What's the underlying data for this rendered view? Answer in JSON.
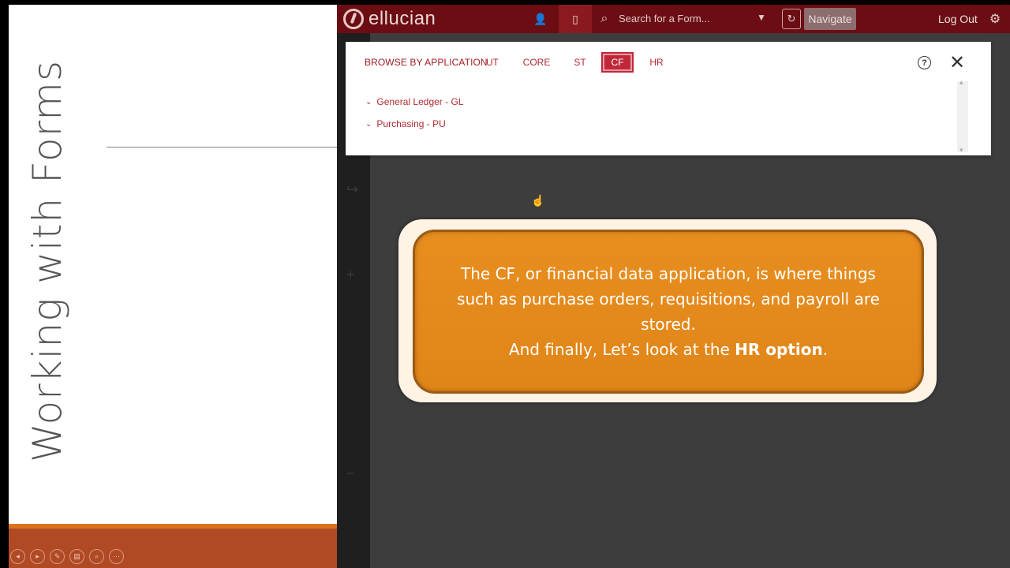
{
  "slide": {
    "title": "Working with Forms",
    "controls": [
      "◂",
      "▸",
      "✎",
      "▤",
      "⌕",
      "⋯"
    ]
  },
  "app": {
    "brand": "ellucian",
    "search_placeholder": "Search for a Form...",
    "navigate_label": "Navigate",
    "logout_label": "Log Out",
    "icons": {
      "user": "👤",
      "doc": "▯",
      "search": "⌕",
      "caret": "▼",
      "history": "↻",
      "gear": "⚙"
    },
    "colors": {
      "topbar": "#6b0d12",
      "accent": "#c0283a",
      "callout": "#e88e1f"
    }
  },
  "browse": {
    "label": "BROWSE BY APPLICATION",
    "tabs": [
      "UT",
      "CORE",
      "ST",
      "CF",
      "HR"
    ],
    "selected_tab": "CF",
    "help_glyph": "?",
    "close_glyph": "✕",
    "items": [
      "General Ledger - GL",
      "Purchasing - PU"
    ],
    "chevron": "⌄"
  },
  "callout": {
    "line1": "The CF, or financial data application, is where things such as purchase orders, requisitions, and payroll are stored.",
    "line2_prefix": "And finally, Let’s look at the ",
    "line2_bold": "HR option",
    "line2_suffix": "."
  }
}
